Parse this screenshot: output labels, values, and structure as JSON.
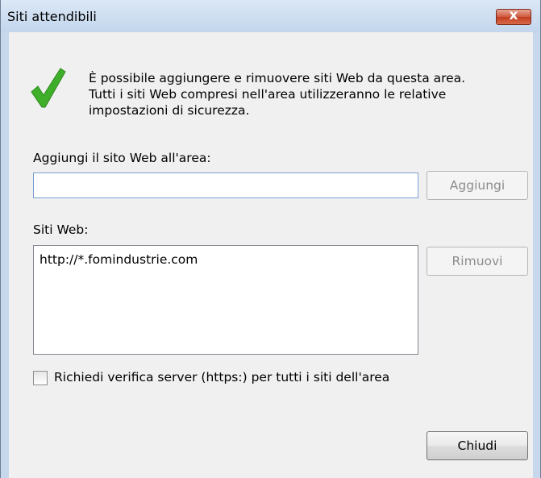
{
  "window": {
    "title": "Siti attendibili",
    "close_symbol": "x"
  },
  "info": {
    "icon": "green-check-icon",
    "line1": "È possibile aggiungere e rimuovere siti Web da questa area.",
    "line2": "Tutti i siti Web compresi nell'area utilizzeranno le relative",
    "line3": "impostazioni di sicurezza."
  },
  "add": {
    "label": "Aggiungi il sito Web all'area:",
    "value": "",
    "button_label": "Aggiungi"
  },
  "sites": {
    "label": "Siti Web:",
    "items": [
      "http://*.fomindustrie.com"
    ],
    "remove_label": "Rimuovi"
  },
  "https": {
    "label": "Richiedi verifica server (https:) per tutti i siti dell'area",
    "checked": false
  },
  "close_label": "Chiudi",
  "colors": {
    "check_green": "#3fae2a",
    "titlebar": "#c7d8ec",
    "close_red": "#c94b2f"
  }
}
